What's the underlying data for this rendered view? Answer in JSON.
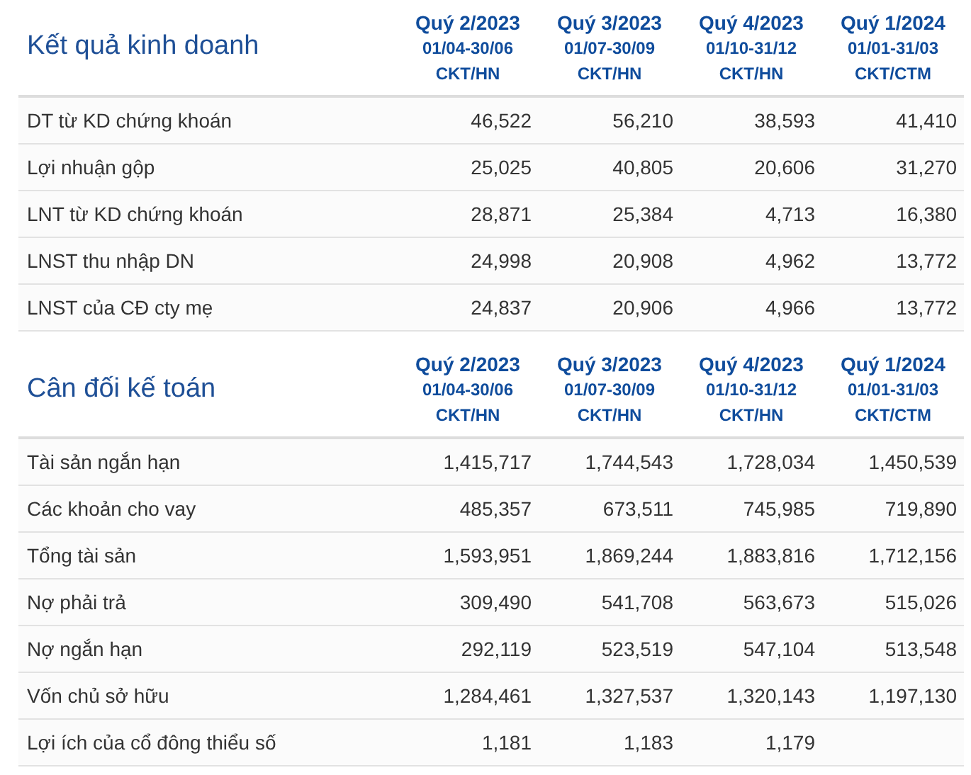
{
  "sections": [
    {
      "title": "Kết quả kinh doanh",
      "columns": [
        {
          "period": "Quý 2/2023",
          "range": "01/04-30/06",
          "audit": "CKT/HN"
        },
        {
          "period": "Quý 3/2023",
          "range": "01/07-30/09",
          "audit": "CKT/HN"
        },
        {
          "period": "Quý 4/2023",
          "range": "01/10-31/12",
          "audit": "CKT/HN"
        },
        {
          "period": "Quý 1/2024",
          "range": "01/01-31/03",
          "audit": "CKT/CTM"
        }
      ],
      "rows": [
        {
          "label": "DT từ KD chứng khoán",
          "values": [
            "46,522",
            "56,210",
            "38,593",
            "41,410"
          ]
        },
        {
          "label": "Lợi nhuận gộp",
          "values": [
            "25,025",
            "40,805",
            "20,606",
            "31,270"
          ]
        },
        {
          "label": "LNT từ KD chứng khoán",
          "values": [
            "28,871",
            "25,384",
            "4,713",
            "16,380"
          ]
        },
        {
          "label": "LNST thu nhập DN",
          "values": [
            "24,998",
            "20,908",
            "4,962",
            "13,772"
          ]
        },
        {
          "label": "LNST của CĐ cty mẹ",
          "values": [
            "24,837",
            "20,906",
            "4,966",
            "13,772"
          ]
        }
      ]
    },
    {
      "title": "Cân đối kế toán",
      "columns": [
        {
          "period": "Quý 2/2023",
          "range": "01/04-30/06",
          "audit": "CKT/HN"
        },
        {
          "period": "Quý 3/2023",
          "range": "01/07-30/09",
          "audit": "CKT/HN"
        },
        {
          "period": "Quý 4/2023",
          "range": "01/10-31/12",
          "audit": "CKT/HN"
        },
        {
          "period": "Quý 1/2024",
          "range": "01/01-31/03",
          "audit": "CKT/CTM"
        }
      ],
      "rows": [
        {
          "label": "Tài sản ngắn hạn",
          "values": [
            "1,415,717",
            "1,744,543",
            "1,728,034",
            "1,450,539"
          ]
        },
        {
          "label": "Các khoản cho vay",
          "values": [
            "485,357",
            "673,511",
            "745,985",
            "719,890"
          ]
        },
        {
          "label": "Tổng tài sản",
          "values": [
            "1,593,951",
            "1,869,244",
            "1,883,816",
            "1,712,156"
          ]
        },
        {
          "label": "Nợ phải trả",
          "values": [
            "309,490",
            "541,708",
            "563,673",
            "515,026"
          ]
        },
        {
          "label": "Nợ ngắn hạn",
          "values": [
            "292,119",
            "523,519",
            "547,104",
            "513,548"
          ]
        },
        {
          "label": "Vốn chủ sở hữu",
          "values": [
            "1,284,461",
            "1,327,537",
            "1,320,143",
            "1,197,130"
          ]
        },
        {
          "label": "Lợi ích của cổ đông thiểu số",
          "values": [
            "1,181",
            "1,183",
            "1,179"
          ]
        }
      ]
    }
  ]
}
